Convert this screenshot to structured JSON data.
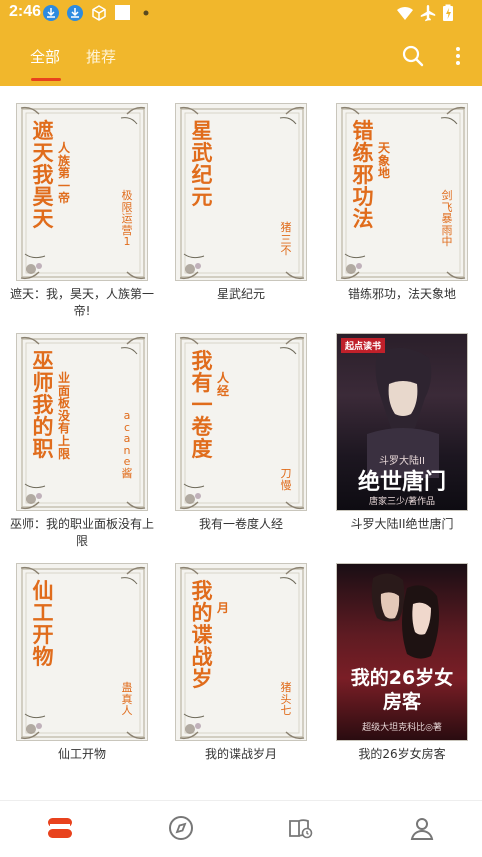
{
  "status_bar": {
    "time": "2:46",
    "icons": [
      "download-icon",
      "download-icon",
      "package-icon",
      "square-icon",
      "dot-icon",
      "wifi-icon",
      "airplane-icon",
      "battery-icon"
    ]
  },
  "tabs": [
    {
      "label": "全部",
      "active": true
    },
    {
      "label": "推荐",
      "active": false
    }
  ],
  "toolbar_icons": [
    "search-icon",
    "more-vert-icon"
  ],
  "books": [
    {
      "title": "遮天：我，昊天，人族第一帝!",
      "cover_type": "scroll",
      "cover_title": "遮天我昊天",
      "cover_subtitle": "人族第一帝",
      "cover_author": "极限运营1"
    },
    {
      "title": "星武纪元",
      "cover_type": "scroll",
      "cover_title": "星武纪元",
      "cover_subtitle": "",
      "cover_author": "猪三不"
    },
    {
      "title": "错练邪功，法天象地",
      "cover_type": "scroll",
      "cover_title": "错练邪功法",
      "cover_subtitle": "天象地",
      "cover_author": "剑飞暴雨中"
    },
    {
      "title": "巫师：我的职业面板没有上限",
      "cover_type": "scroll",
      "cover_title": "巫师我的职",
      "cover_subtitle": "业面板没有上限",
      "cover_author": "acane酱"
    },
    {
      "title": "我有一卷度人经",
      "cover_type": "scroll",
      "cover_title": "我有一卷度",
      "cover_subtitle": "人经",
      "cover_author": "刀慢"
    },
    {
      "title": "斗罗大陆II绝世唐门",
      "cover_type": "poster",
      "poster_logo": "起点读书",
      "poster_title": "绝世唐门",
      "poster_top": "斗罗大陆II",
      "poster_author": "唐家三少/著作品"
    },
    {
      "title": "仙工开物",
      "cover_type": "scroll",
      "cover_title": "仙工开物",
      "cover_subtitle": "",
      "cover_author": "蛊真人"
    },
    {
      "title": "我的谍战岁月",
      "cover_type": "scroll",
      "cover_title": "我的谍战岁",
      "cover_subtitle": "月",
      "cover_author": "猪头七"
    },
    {
      "title": "我的26岁女房客",
      "cover_type": "poster",
      "poster_logo": "",
      "poster_title": "我的26岁女房客",
      "poster_top": "",
      "poster_author": "超级大坦克科比◎著"
    }
  ],
  "bottom_nav": [
    {
      "icon": "bookshelf-icon",
      "active": true
    },
    {
      "icon": "compass-icon",
      "active": false
    },
    {
      "icon": "book-history-icon",
      "active": false
    },
    {
      "icon": "profile-icon",
      "active": false
    }
  ],
  "colors": {
    "accent": "#f1b72c",
    "active_nav": "#e8421d",
    "cover_text": "#e06c1c"
  }
}
